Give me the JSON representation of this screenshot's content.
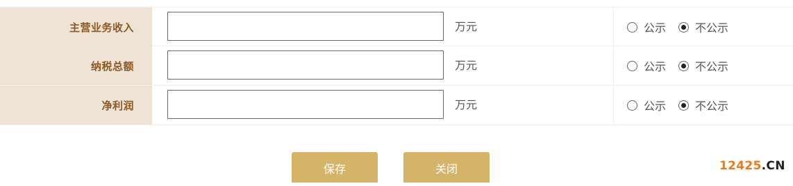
{
  "form": {
    "rows": [
      {
        "label": "主营业务收入",
        "value": "",
        "unit": "万元",
        "options": [
          {
            "label": "公示",
            "checked": false
          },
          {
            "label": "不公示",
            "checked": true
          }
        ]
      },
      {
        "label": "纳税总额",
        "value": "",
        "unit": "万元",
        "options": [
          {
            "label": "公示",
            "checked": false
          },
          {
            "label": "不公示",
            "checked": true
          }
        ]
      },
      {
        "label": "净利润",
        "value": "",
        "unit": "万元",
        "options": [
          {
            "label": "公示",
            "checked": false
          },
          {
            "label": "不公示",
            "checked": true
          }
        ]
      }
    ]
  },
  "actions": {
    "save_label": "保存",
    "close_label": "关闭"
  },
  "watermark": {
    "number": "12425",
    "domain": ".CN"
  },
  "colors": {
    "label_bg": "#efe3d6",
    "label_text": "#8a5a22",
    "button_bg": "#d5b46a",
    "watermark_number": "#ec7a1c"
  }
}
